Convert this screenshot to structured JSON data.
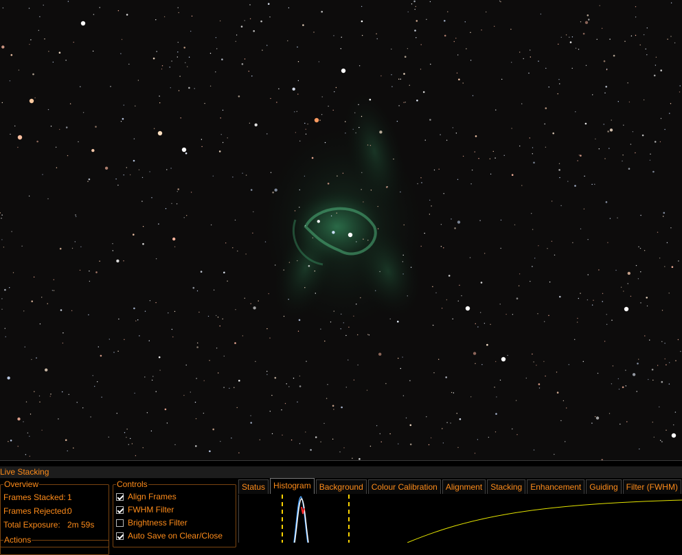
{
  "live_stacking": {
    "title": "Live Stacking",
    "overview": {
      "legend": "Overview",
      "frames_stacked_label": "Frames Stacked:",
      "frames_stacked_value": "1",
      "frames_rejected_label": "Frames Rejected:",
      "frames_rejected_value": "0",
      "total_exposure_label": "Total Exposure:",
      "total_exposure_value": "2m 59s"
    },
    "actions_legend": "Actions",
    "controls": {
      "legend": "Controls",
      "items": [
        {
          "label": "Align Frames",
          "checked": true
        },
        {
          "label": "FWHM Filter",
          "checked": true
        },
        {
          "label": "Brightness Filter",
          "checked": false
        },
        {
          "label": "Auto Save on Clear/Close",
          "checked": true
        }
      ]
    },
    "tabs": [
      "Status",
      "Histogram",
      "Background",
      "Colour Calibration",
      "Alignment",
      "Stacking",
      "Enhancement",
      "Guiding",
      "Filter (FWHM)"
    ],
    "active_tab": "Histogram"
  },
  "colors": {
    "accent": "#ff8c1a",
    "nebula": "#2f8a55",
    "histogram_marker": "#ffd400",
    "panel_border": "#7a4410"
  }
}
